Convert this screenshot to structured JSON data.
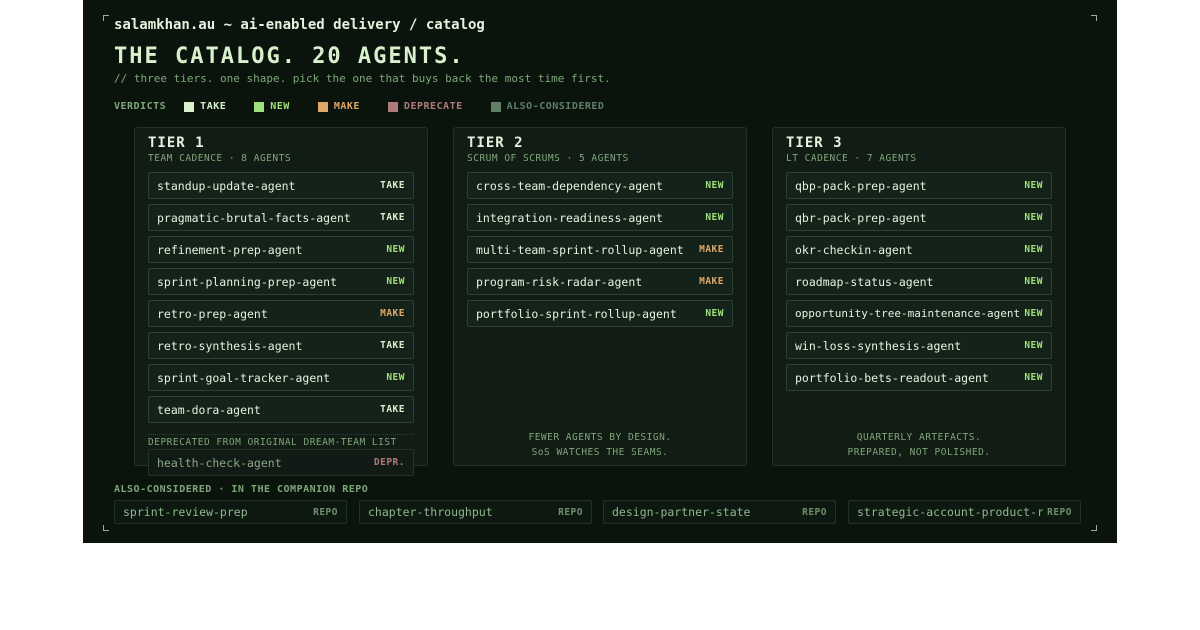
{
  "header": {
    "breadcrumb": "salamkhan.au ~ ai-enabled delivery / catalog",
    "title": "THE CATALOG. 20 AGENTS.",
    "subtitle": "// three tiers. one shape. pick the one that buys back the most time first."
  },
  "legend": {
    "title": "VERDICTS",
    "items": [
      {
        "label": "TAKE",
        "color": "#d9f0cc"
      },
      {
        "label": "NEW",
        "color": "#9ee07a"
      },
      {
        "label": "MAKE",
        "color": "#e0a866"
      },
      {
        "label": "DEPRECATE",
        "color": "#b07a7a"
      },
      {
        "label": "ALSO-CONSIDERED",
        "color": "#5f7f66"
      }
    ]
  },
  "colors": {
    "TAKE": "#d9f0cc",
    "NEW": "#9ee07a",
    "MAKE": "#e0a866",
    "DEPR.": "#b07a7a"
  },
  "tiers": [
    {
      "title": "TIER 1",
      "subtitle": "TEAM CADENCE · 8 AGENTS",
      "agents": [
        {
          "name": "standup-update-agent",
          "tag": "TAKE"
        },
        {
          "name": "pragmatic-brutal-facts-agent",
          "tag": "TAKE"
        },
        {
          "name": "refinement-prep-agent",
          "tag": "NEW"
        },
        {
          "name": "sprint-planning-prep-agent",
          "tag": "NEW"
        },
        {
          "name": "retro-prep-agent",
          "tag": "MAKE"
        },
        {
          "name": "retro-synthesis-agent",
          "tag": "TAKE"
        },
        {
          "name": "sprint-goal-tracker-agent",
          "tag": "NEW"
        },
        {
          "name": "team-dora-agent",
          "tag": "TAKE"
        }
      ],
      "deprecated_label": "DEPRECATED FROM ORIGINAL DREAM-TEAM LIST",
      "deprecated": {
        "name": "health-check-agent",
        "tag": "DEPR."
      }
    },
    {
      "title": "TIER 2",
      "subtitle": "SCRUM OF SCRUMS · 5 AGENTS",
      "agents": [
        {
          "name": "cross-team-dependency-agent",
          "tag": "NEW"
        },
        {
          "name": "integration-readiness-agent",
          "tag": "NEW"
        },
        {
          "name": "multi-team-sprint-rollup-agent",
          "tag": "MAKE"
        },
        {
          "name": "program-risk-radar-agent",
          "tag": "MAKE"
        },
        {
          "name": "portfolio-sprint-rollup-agent",
          "tag": "NEW"
        }
      ],
      "note_line1": "FEWER AGENTS BY DESIGN.",
      "note_line2": "SoS WATCHES THE SEAMS."
    },
    {
      "title": "TIER 3",
      "subtitle": "LT CADENCE · 7 AGENTS",
      "agents": [
        {
          "name": "qbp-pack-prep-agent",
          "tag": "NEW"
        },
        {
          "name": "qbr-pack-prep-agent",
          "tag": "NEW"
        },
        {
          "name": "okr-checkin-agent",
          "tag": "NEW"
        },
        {
          "name": "roadmap-status-agent",
          "tag": "NEW"
        },
        {
          "name": "opportunity-tree-maintenance-agent",
          "tag": "NEW"
        },
        {
          "name": "win-loss-synthesis-agent",
          "tag": "NEW"
        },
        {
          "name": "portfolio-bets-readout-agent",
          "tag": "NEW"
        }
      ],
      "note_line1": "QUARTERLY ARTEFACTS.",
      "note_line2": "PREPARED, NOT POLISHED."
    }
  ],
  "also_considered": {
    "title": "ALSO-CONSIDERED · IN THE COMPANION REPO",
    "items": [
      {
        "name": "sprint-review-prep",
        "tag": "REPO"
      },
      {
        "name": "chapter-throughput",
        "tag": "REPO"
      },
      {
        "name": "design-partner-state",
        "tag": "REPO"
      },
      {
        "name": "strategic-account-product-review",
        "tag": "REPO"
      }
    ]
  }
}
